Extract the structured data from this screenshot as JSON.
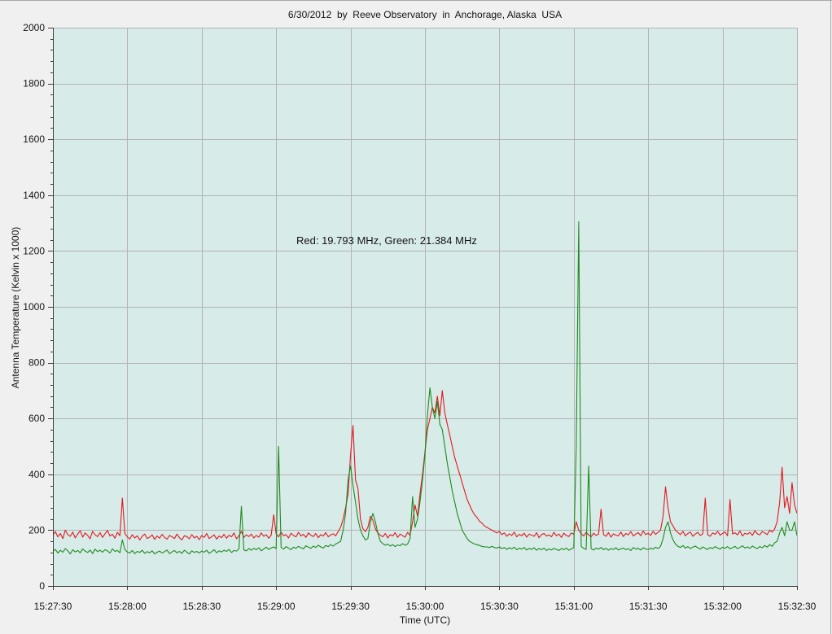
{
  "chart_data": {
    "type": "line",
    "title": "6/30/2012  by  Reeve Observatory  in  Anchorage, Alaska  USA",
    "xlabel": "Time (UTC)",
    "ylabel": "Antenna Temperature (Kelvin x 1000)",
    "annotation": "Red: 19.793 MHz, Green: 21.384 MHz",
    "xlim": [
      "15:27:30",
      "15:32:30"
    ],
    "ylim": [
      0,
      2000
    ],
    "grid": true,
    "background_color": "#d7ebe8",
    "x_ticks": [
      "15:27:30",
      "15:28:00",
      "15:28:30",
      "15:29:00",
      "15:29:30",
      "15:30:00",
      "15:30:30",
      "15:31:00",
      "15:31:30",
      "15:32:00",
      "15:32:30"
    ],
    "y_ticks": [
      0,
      200,
      400,
      600,
      800,
      1000,
      1200,
      1400,
      1600,
      1800,
      2000
    ],
    "x": [
      "15:27:30",
      "15:27:31",
      "15:27:32",
      "15:27:33",
      "15:27:34",
      "15:27:35",
      "15:27:36",
      "15:27:37",
      "15:27:38",
      "15:27:39",
      "15:27:40",
      "15:27:41",
      "15:27:42",
      "15:27:43",
      "15:27:44",
      "15:27:45",
      "15:27:46",
      "15:27:47",
      "15:27:48",
      "15:27:49",
      "15:27:50",
      "15:27:51",
      "15:27:52",
      "15:27:53",
      "15:27:54",
      "15:27:55",
      "15:27:56",
      "15:27:57",
      "15:27:58",
      "15:27:59",
      "15:28:00",
      "15:28:01",
      "15:28:02",
      "15:28:03",
      "15:28:04",
      "15:28:05",
      "15:28:06",
      "15:28:07",
      "15:28:08",
      "15:28:09",
      "15:28:10",
      "15:28:11",
      "15:28:12",
      "15:28:13",
      "15:28:14",
      "15:28:15",
      "15:28:16",
      "15:28:17",
      "15:28:18",
      "15:28:19",
      "15:28:20",
      "15:28:21",
      "15:28:22",
      "15:28:23",
      "15:28:24",
      "15:28:25",
      "15:28:26",
      "15:28:27",
      "15:28:28",
      "15:28:29",
      "15:28:30",
      "15:28:31",
      "15:28:32",
      "15:28:33",
      "15:28:34",
      "15:28:35",
      "15:28:36",
      "15:28:37",
      "15:28:38",
      "15:28:39",
      "15:28:40",
      "15:28:41",
      "15:28:42",
      "15:28:43",
      "15:28:44",
      "15:28:45",
      "15:28:46",
      "15:28:47",
      "15:28:48",
      "15:28:49",
      "15:28:50",
      "15:28:51",
      "15:28:52",
      "15:28:53",
      "15:28:54",
      "15:28:55",
      "15:28:56",
      "15:28:57",
      "15:28:58",
      "15:28:59",
      "15:29:00",
      "15:29:01",
      "15:29:02",
      "15:29:03",
      "15:29:04",
      "15:29:05",
      "15:29:06",
      "15:29:07",
      "15:29:08",
      "15:29:09",
      "15:29:10",
      "15:29:11",
      "15:29:12",
      "15:29:13",
      "15:29:14",
      "15:29:15",
      "15:29:16",
      "15:29:17",
      "15:29:18",
      "15:29:19",
      "15:29:20",
      "15:29:21",
      "15:29:22",
      "15:29:23",
      "15:29:24",
      "15:29:25",
      "15:29:26",
      "15:29:27",
      "15:29:28",
      "15:29:29",
      "15:29:30",
      "15:29:31",
      "15:29:32",
      "15:29:33",
      "15:29:34",
      "15:29:35",
      "15:29:36",
      "15:29:37",
      "15:29:38",
      "15:29:39",
      "15:29:40",
      "15:29:41",
      "15:29:42",
      "15:29:43",
      "15:29:44",
      "15:29:45",
      "15:29:46",
      "15:29:47",
      "15:29:48",
      "15:29:49",
      "15:29:50",
      "15:29:51",
      "15:29:52",
      "15:29:53",
      "15:29:54",
      "15:29:55",
      "15:29:56",
      "15:29:57",
      "15:29:58",
      "15:29:59",
      "15:30:00",
      "15:30:01",
      "15:30:02",
      "15:30:03",
      "15:30:04",
      "15:30:05",
      "15:30:06",
      "15:30:07",
      "15:30:08",
      "15:30:09",
      "15:30:10",
      "15:30:11",
      "15:30:12",
      "15:30:13",
      "15:30:14",
      "15:30:15",
      "15:30:16",
      "15:30:17",
      "15:30:18",
      "15:30:19",
      "15:30:20",
      "15:30:21",
      "15:30:22",
      "15:30:23",
      "15:30:24",
      "15:30:25",
      "15:30:26",
      "15:30:27",
      "15:30:28",
      "15:30:29",
      "15:30:30",
      "15:30:31",
      "15:30:32",
      "15:30:33",
      "15:30:34",
      "15:30:35",
      "15:30:36",
      "15:30:37",
      "15:30:38",
      "15:30:39",
      "15:30:40",
      "15:30:41",
      "15:30:42",
      "15:30:43",
      "15:30:44",
      "15:30:45",
      "15:30:46",
      "15:30:47",
      "15:30:48",
      "15:30:49",
      "15:30:50",
      "15:30:51",
      "15:30:52",
      "15:30:53",
      "15:30:54",
      "15:30:55",
      "15:30:56",
      "15:30:57",
      "15:30:58",
      "15:30:59",
      "15:31:00",
      "15:31:01",
      "15:31:02",
      "15:31:03",
      "15:31:04",
      "15:31:05",
      "15:31:06",
      "15:31:07",
      "15:31:08",
      "15:31:09",
      "15:31:10",
      "15:31:11",
      "15:31:12",
      "15:31:13",
      "15:31:14",
      "15:31:15",
      "15:31:16",
      "15:31:17",
      "15:31:18",
      "15:31:19",
      "15:31:20",
      "15:31:21",
      "15:31:22",
      "15:31:23",
      "15:31:24",
      "15:31:25",
      "15:31:26",
      "15:31:27",
      "15:31:28",
      "15:31:29",
      "15:31:30",
      "15:31:31",
      "15:31:32",
      "15:31:33",
      "15:31:34",
      "15:31:35",
      "15:31:36",
      "15:31:37",
      "15:31:38",
      "15:31:39",
      "15:31:40",
      "15:31:41",
      "15:31:42",
      "15:31:43",
      "15:31:44",
      "15:31:45",
      "15:31:46",
      "15:31:47",
      "15:31:48",
      "15:31:49",
      "15:31:50",
      "15:31:51",
      "15:31:52",
      "15:31:53",
      "15:31:54",
      "15:31:55",
      "15:31:56",
      "15:31:57",
      "15:31:58",
      "15:31:59",
      "15:32:00",
      "15:32:01",
      "15:32:02",
      "15:32:03",
      "15:32:04",
      "15:32:05",
      "15:32:06",
      "15:32:07",
      "15:32:08",
      "15:32:09",
      "15:32:10",
      "15:32:11",
      "15:32:12",
      "15:32:13",
      "15:32:14",
      "15:32:15",
      "15:32:16",
      "15:32:17",
      "15:32:18",
      "15:32:19",
      "15:32:20",
      "15:32:21",
      "15:32:22",
      "15:32:23",
      "15:32:24",
      "15:32:25",
      "15:32:26",
      "15:32:27",
      "15:32:28",
      "15:32:29",
      "15:32:30"
    ],
    "series": [
      {
        "color": "#e4171e",
        "values": [
          182,
          195,
          176,
          188,
          170,
          200,
          184,
          178,
          193,
          172,
          186,
          198,
          175,
          190,
          181,
          169,
          196,
          183,
          177,
          191,
          174,
          187,
          199,
          179,
          185,
          171,
          192,
          180,
          315,
          188,
          176,
          168,
          184,
          172,
          180,
          165,
          178,
          186,
          170,
          175,
          183,
          167,
          179,
          171,
          185,
          174,
          168,
          181,
          176,
          170,
          186,
          173,
          165,
          180,
          177,
          169,
          184,
          172,
          178,
          166,
          181,
          174,
          188,
          170,
          176,
          183,
          168,
          179,
          173,
          185,
          171,
          182,
          176,
          190,
          169,
          180,
          196,
          174,
          183,
          177,
          186,
          172,
          181,
          175,
          190,
          178,
          184,
          171,
          182,
          255,
          187,
          176,
          193,
          180,
          184,
          172,
          189,
          181,
          176,
          192,
          179,
          185,
          174,
          190,
          182,
          177,
          188,
          173,
          184,
          179,
          191,
          176,
          183,
          187,
          180,
          195,
          210,
          240,
          280,
          330,
          470,
          575,
          380,
          350,
          240,
          205,
          195,
          210,
          250,
          235,
          205,
          190,
          182,
          176,
          188,
          172,
          184,
          179,
          191,
          174,
          186,
          180,
          175,
          192,
          181,
          230,
          290,
          250,
          330,
          400,
          480,
          560,
          600,
          640,
          620,
          680,
          610,
          700,
          620,
          580,
          540,
          500,
          460,
          430,
          400,
          370,
          340,
          310,
          290,
          270,
          255,
          245,
          232,
          225,
          215,
          210,
          205,
          200,
          195,
          190,
          196,
          184,
          190,
          178,
          187,
          181,
          193,
          176,
          185,
          180,
          189,
          175,
          186,
          182,
          178,
          191,
          173,
          184,
          188,
          179,
          183,
          176,
          192,
          180,
          186,
          174,
          189,
          181,
          177,
          190,
          185,
          230,
          200,
          188,
          179,
          192,
          183,
          176,
          189,
          181,
          186,
          275,
          184,
          178,
          191,
          175,
          187,
          182,
          180,
          193,
          177,
          188,
          183,
          195,
          179,
          186,
          191,
          180,
          197,
          184,
          189,
          181,
          196,
          185,
          192,
          200,
          250,
          355,
          280,
          230,
          215,
          200,
          191,
          184,
          196,
          180,
          188,
          193,
          178,
          186,
          192,
          181,
          187,
          315,
          184,
          178,
          190,
          185,
          196,
          182,
          188,
          194,
          180,
          310,
          186,
          191,
          183,
          197,
          179,
          189,
          185,
          192,
          181,
          198,
          187,
          183,
          195,
          190,
          184,
          200,
          193,
          205,
          230,
          300,
          425,
          280,
          320,
          260,
          370,
          290,
          260
        ]
      },
      {
        "color": "#1e8a1e",
        "values": [
          124,
          131,
          118,
          128,
          121,
          134,
          126,
          115,
          130,
          122,
          127,
          119,
          133,
          125,
          120,
          129,
          116,
          132,
          123,
          128,
          121,
          130,
          126,
          118,
          133,
          124,
          127,
          119,
          165,
          130,
          122,
          118,
          127,
          116,
          124,
          120,
          128,
          117,
          123,
          119,
          126,
          115,
          121,
          125,
          118,
          123,
          129,
          116,
          122,
          127,
          119,
          124,
          117,
          128,
          121,
          115,
          126,
          120,
          124,
          118,
          125,
          121,
          128,
          117,
          123,
          130,
          119,
          126,
          122,
          128,
          124,
          131,
          120,
          127,
          125,
          133,
          285,
          129,
          126,
          134,
          128,
          135,
          130,
          137,
          126,
          133,
          139,
          131,
          136,
          140,
          134,
          500,
          138,
          132,
          141,
          136,
          130,
          139,
          135,
          142,
          137,
          133,
          144,
          139,
          135,
          143,
          138,
          146,
          140,
          136,
          145,
          141,
          148,
          143,
          150,
          155,
          160,
          200,
          260,
          380,
          430,
          360,
          300,
          240,
          200,
          180,
          165,
          170,
          230,
          260,
          230,
          190,
          160,
          152,
          146,
          150,
          143,
          148,
          141,
          147,
          144,
          152,
          146,
          150,
          170,
          320,
          210,
          240,
          300,
          380,
          470,
          610,
          710,
          640,
          600,
          660,
          580,
          560,
          500,
          440,
          390,
          340,
          300,
          260,
          230,
          200,
          185,
          170,
          160,
          155,
          150,
          148,
          145,
          142,
          140,
          140,
          138,
          142,
          138,
          136,
          140,
          134,
          138,
          131,
          137,
          133,
          139,
          130,
          136,
          132,
          138,
          129,
          135,
          131,
          137,
          128,
          134,
          130,
          136,
          127,
          133,
          129,
          135,
          131,
          127,
          134,
          130,
          136,
          128,
          133,
          137,
          500,
          1305,
          142,
          135,
          131,
          430,
          134,
          129,
          136,
          132,
          138,
          130,
          135,
          128,
          134,
          131,
          137,
          129,
          133,
          136,
          130,
          134,
          127,
          138,
          132,
          135,
          129,
          137,
          133,
          130,
          136,
          132,
          139,
          134,
          142,
          170,
          210,
          230,
          190,
          165,
          150,
          142,
          138,
          145,
          136,
          141,
          134,
          139,
          143,
          137,
          132,
          140,
          135,
          131,
          138,
          134,
          141,
          136,
          132,
          139,
          135,
          141,
          133,
          137,
          142,
          134,
          138,
          144,
          136,
          140,
          135,
          143,
          138,
          134,
          141,
          137,
          145,
          139,
          148,
          142,
          155,
          160,
          190,
          210,
          180,
          230,
          200,
          200,
          230,
          180
        ]
      }
    ]
  }
}
